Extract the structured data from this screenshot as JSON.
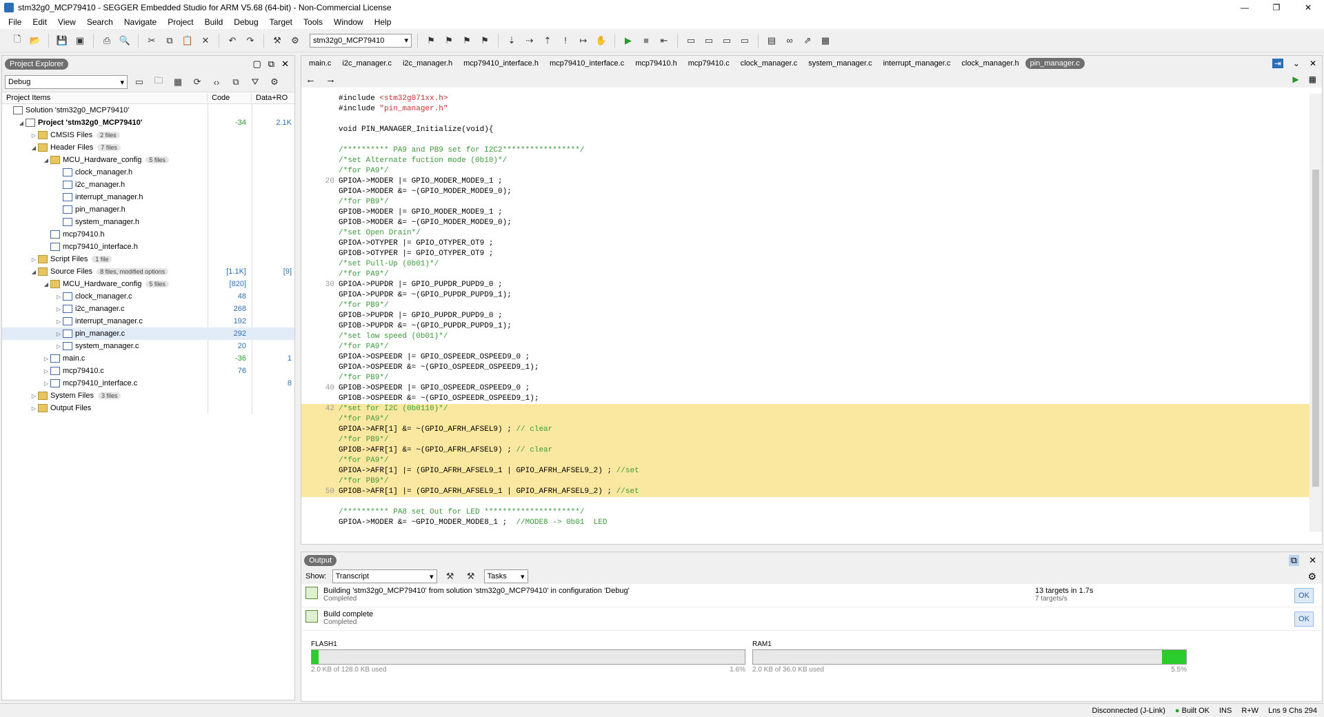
{
  "window": {
    "title": "stm32g0_MCP79410 - SEGGER Embedded Studio for ARM V5.68 (64-bit) - Non-Commercial License",
    "min": "—",
    "max": "❐",
    "close": "✕"
  },
  "menu": [
    "File",
    "Edit",
    "View",
    "Search",
    "Navigate",
    "Project",
    "Build",
    "Debug",
    "Target",
    "Tools",
    "Window",
    "Help"
  ],
  "toolbar": {
    "project_combo": "stm32g0_MCP79410"
  },
  "project_explorer": {
    "title": "Project Explorer",
    "config": "Debug",
    "col_items": "Project Items",
    "col_code": "Code",
    "col_data": "Data+RO",
    "rows": [
      {
        "label": "Solution 'stm32g0_MCP79410'",
        "indent": 0,
        "tri": "",
        "icon": "proj",
        "badge": "",
        "code": "",
        "data": "",
        "bold": false
      },
      {
        "label": "Project 'stm32g0_MCP79410'",
        "indent": 1,
        "tri": "◢",
        "icon": "proj",
        "badge": "",
        "code": "-34",
        "data": "2.1K",
        "bold": true
      },
      {
        "label": "CMSIS Files",
        "indent": 2,
        "tri": "▷",
        "icon": "folder",
        "badge": "2 files",
        "code": "",
        "data": "",
        "bold": false
      },
      {
        "label": "Header Files",
        "indent": 2,
        "tri": "◢",
        "icon": "folder",
        "badge": "7 files",
        "code": "",
        "data": "",
        "bold": false
      },
      {
        "label": "MCU_Hardware_config",
        "indent": 3,
        "tri": "◢",
        "icon": "folder",
        "badge": "5 files",
        "code": "",
        "data": "",
        "bold": false
      },
      {
        "label": "clock_manager.h",
        "indent": 4,
        "tri": "",
        "icon": "fileh",
        "badge": "",
        "code": "",
        "data": "",
        "bold": false
      },
      {
        "label": "i2c_manager.h",
        "indent": 4,
        "tri": "",
        "icon": "fileh",
        "badge": "",
        "code": "",
        "data": "",
        "bold": false
      },
      {
        "label": "interrupt_manager.h",
        "indent": 4,
        "tri": "",
        "icon": "fileh",
        "badge": "",
        "code": "",
        "data": "",
        "bold": false
      },
      {
        "label": "pin_manager.h",
        "indent": 4,
        "tri": "",
        "icon": "fileh",
        "badge": "",
        "code": "",
        "data": "",
        "bold": false
      },
      {
        "label": "system_manager.h",
        "indent": 4,
        "tri": "",
        "icon": "fileh",
        "badge": "",
        "code": "",
        "data": "",
        "bold": false
      },
      {
        "label": "mcp79410.h",
        "indent": 3,
        "tri": "",
        "icon": "fileh",
        "badge": "",
        "code": "",
        "data": "",
        "bold": false
      },
      {
        "label": "mcp79410_interface.h",
        "indent": 3,
        "tri": "",
        "icon": "fileh",
        "badge": "",
        "code": "",
        "data": "",
        "bold": false
      },
      {
        "label": "Script Files",
        "indent": 2,
        "tri": "▷",
        "icon": "folder",
        "badge": "1 file",
        "code": "",
        "data": "",
        "bold": false
      },
      {
        "label": "Source Files",
        "indent": 2,
        "tri": "◢",
        "icon": "folder",
        "badge": "8 files, modified options",
        "code": "[1.1K]",
        "data": "[9]",
        "bold": false
      },
      {
        "label": "MCU_Hardware_config",
        "indent": 3,
        "tri": "◢",
        "icon": "folder",
        "badge": "5 files",
        "code": "[820]",
        "data": "",
        "bold": false
      },
      {
        "label": "clock_manager.c",
        "indent": 4,
        "tri": "▷",
        "icon": "filec",
        "badge": "",
        "code": "48",
        "data": "",
        "bold": false
      },
      {
        "label": "i2c_manager.c",
        "indent": 4,
        "tri": "▷",
        "icon": "filec",
        "badge": "",
        "code": "268",
        "data": "",
        "bold": false
      },
      {
        "label": "interrupt_manager.c",
        "indent": 4,
        "tri": "▷",
        "icon": "filec",
        "badge": "",
        "code": "192",
        "data": "",
        "bold": false
      },
      {
        "label": "pin_manager.c",
        "indent": 4,
        "tri": "▷",
        "icon": "filec",
        "badge": "",
        "code": "292",
        "data": "",
        "bold": false,
        "sel": true
      },
      {
        "label": "system_manager.c",
        "indent": 4,
        "tri": "▷",
        "icon": "filec",
        "badge": "",
        "code": "20",
        "data": "",
        "bold": false
      },
      {
        "label": "main.c",
        "indent": 3,
        "tri": "▷",
        "icon": "filec",
        "badge": "",
        "code": "-36",
        "data": "1",
        "bold": false
      },
      {
        "label": "mcp79410.c",
        "indent": 3,
        "tri": "▷",
        "icon": "filec",
        "badge": "",
        "code": "76",
        "data": "",
        "bold": false
      },
      {
        "label": "mcp79410_interface.c",
        "indent": 3,
        "tri": "▷",
        "icon": "filec",
        "badge": "",
        "code": "",
        "data": "8",
        "bold": false
      },
      {
        "label": "System Files",
        "indent": 2,
        "tri": "▷",
        "icon": "folder",
        "badge": "3 files",
        "code": "",
        "data": "",
        "bold": false
      },
      {
        "label": "Output Files",
        "indent": 2,
        "tri": "▷",
        "icon": "folder",
        "badge": "",
        "code": "",
        "data": "",
        "bold": false
      }
    ]
  },
  "editor": {
    "tabs": [
      "main.c",
      "i2c_manager.c",
      "i2c_manager.h",
      "mcp79410_interface.h",
      "mcp79410_interface.c",
      "mcp79410.h",
      "mcp79410.c",
      "clock_manager.c",
      "system_manager.c",
      "interrupt_manager.c",
      "clock_manager.h",
      "pin_manager.c"
    ],
    "active_tab": "pin_manager.c",
    "lines": [
      {
        "n": "",
        "t": "#include <stm32g071xx.h>",
        "k": "inc1"
      },
      {
        "n": "",
        "t": "#include \"pin_manager.h\"",
        "k": "inc2"
      },
      {
        "n": "",
        "t": "",
        "k": ""
      },
      {
        "n": "",
        "t": "void PIN_MANAGER_Initialize(void){",
        "k": ""
      },
      {
        "n": "",
        "t": "",
        "k": ""
      },
      {
        "n": "",
        "t": "/********** PA9 and PB9 set for I2C2*****************/",
        "k": "cm"
      },
      {
        "n": "",
        "t": "/*set Alternate fuction mode (0b10)*/",
        "k": "cm"
      },
      {
        "n": "",
        "t": "/*for PA9*/",
        "k": "cm"
      },
      {
        "n": "20",
        "t": "GPIOA->MODER |= GPIO_MODER_MODE9_1 ;",
        "k": ""
      },
      {
        "n": "",
        "t": "GPIOA->MODER &= ~(GPIO_MODER_MODE9_0);",
        "k": ""
      },
      {
        "n": "",
        "t": "/*for PB9*/",
        "k": "cm"
      },
      {
        "n": "",
        "t": "GPIOB->MODER |= GPIO_MODER_MODE9_1 ;",
        "k": ""
      },
      {
        "n": "",
        "t": "GPIOB->MODER &= ~(GPIO_MODER_MODE9_0);",
        "k": ""
      },
      {
        "n": "",
        "t": "/*set Open Drain*/",
        "k": "cm"
      },
      {
        "n": "",
        "t": "GPIOA->OTYPER |= GPIO_OTYPER_OT9 ;",
        "k": ""
      },
      {
        "n": "",
        "t": "GPIOB->OTYPER |= GPIO_OTYPER_OT9 ;",
        "k": ""
      },
      {
        "n": "",
        "t": "/*set Pull-Up (0b01)*/",
        "k": "cm"
      },
      {
        "n": "",
        "t": "/*for PA9*/",
        "k": "cm"
      },
      {
        "n": "30",
        "t": "GPIOA->PUPDR |= GPIO_PUPDR_PUPD9_0 ;",
        "k": ""
      },
      {
        "n": "",
        "t": "GPIOA->PUPDR &= ~(GPIO_PUPDR_PUPD9_1);",
        "k": ""
      },
      {
        "n": "",
        "t": "/*for PB9*/",
        "k": "cm"
      },
      {
        "n": "",
        "t": "GPIOB->PUPDR |= GPIO_PUPDR_PUPD9_0 ;",
        "k": ""
      },
      {
        "n": "",
        "t": "GPIOB->PUPDR &= ~(GPIO_PUPDR_PUPD9_1);",
        "k": ""
      },
      {
        "n": "",
        "t": "/*set low speed (0b01)*/",
        "k": "cm"
      },
      {
        "n": "",
        "t": "/*for PA9*/",
        "k": "cm"
      },
      {
        "n": "",
        "t": "GPIOA->OSPEEDR |= GPIO_OSPEEDR_OSPEED9_0 ;",
        "k": ""
      },
      {
        "n": "",
        "t": "GPIOA->OSPEEDR &= ~(GPIO_OSPEEDR_OSPEED9_1);",
        "k": ""
      },
      {
        "n": "",
        "t": "/*for PB9*/",
        "k": "cm"
      },
      {
        "n": "40",
        "t": "GPIOB->OSPEEDR |= GPIO_OSPEEDR_OSPEED9_0 ;",
        "k": ""
      },
      {
        "n": "",
        "t": "GPIOB->OSPEEDR &= ~(GPIO_OSPEEDR_OSPEED9_1);",
        "k": ""
      },
      {
        "n": "42",
        "t": "/*set for I2C (0b0110)*/",
        "k": "cm",
        "hl": true
      },
      {
        "n": "",
        "t": "/*for PA9*/",
        "k": "cm",
        "hl": true
      },
      {
        "n": "",
        "t": "GPIOA->AFR[1] &= ~(GPIO_AFRH_AFSEL9) ; // clear",
        "k": "",
        "hl": true
      },
      {
        "n": "",
        "t": "/*for PB9*/",
        "k": "cm",
        "hl": true
      },
      {
        "n": "",
        "t": "GPIOB->AFR[1] &= ~(GPIO_AFRH_AFSEL9) ; // clear",
        "k": "",
        "hl": true
      },
      {
        "n": "",
        "t": "/*for PA9*/",
        "k": "cm",
        "hl": true
      },
      {
        "n": "",
        "t": "GPIOA->AFR[1] |= (GPIO_AFRH_AFSEL9_1 | GPIO_AFRH_AFSEL9_2) ; //set",
        "k": "",
        "hl": true
      },
      {
        "n": "",
        "t": "/*for PB9*/",
        "k": "cm",
        "hl": true
      },
      {
        "n": "50",
        "t": "GPIOB->AFR[1] |= (GPIO_AFRH_AFSEL9_1 | GPIO_AFRH_AFSEL9_2) ; //set",
        "k": "",
        "hl": true
      },
      {
        "n": "",
        "t": "",
        "k": ""
      },
      {
        "n": "",
        "t": "/********** PA8 set Out for LED *********************/",
        "k": "cm"
      },
      {
        "n": "",
        "t": "GPIOA->MODER &= ~GPIO_MODER_MODE8_1 ;  //MODE8 -> 0b01  LED",
        "k": ""
      }
    ]
  },
  "output": {
    "title": "Output",
    "show_label": "Show:",
    "show_value": "Transcript",
    "tasks_value": "Tasks",
    "messages": [
      {
        "text": "Building 'stm32g0_MCP79410' from solution 'stm32g0_MCP79410' in configuration 'Debug'",
        "sub": "Completed",
        "right1": "13 targets in 1.7s",
        "right2": "7 targets/s",
        "ok": "OK"
      },
      {
        "text": "Build complete",
        "sub": "Completed",
        "right1": "",
        "right2": "",
        "ok": "OK"
      }
    ],
    "flash": {
      "label": "FLASH1",
      "used": "2.0 KB of 128.0 KB used",
      "pct": "1.6%",
      "fraction": 0.016
    },
    "ram": {
      "label": "RAM1",
      "used": "2.0 KB of 36.0 KB used",
      "pct": "5.5%",
      "fraction": 0.055
    }
  },
  "status": {
    "conn": "Disconnected (J-Link)",
    "built": "Built OK",
    "ins": "INS",
    "rw": "R+W",
    "pos": "Lns 9 Chs 294"
  }
}
